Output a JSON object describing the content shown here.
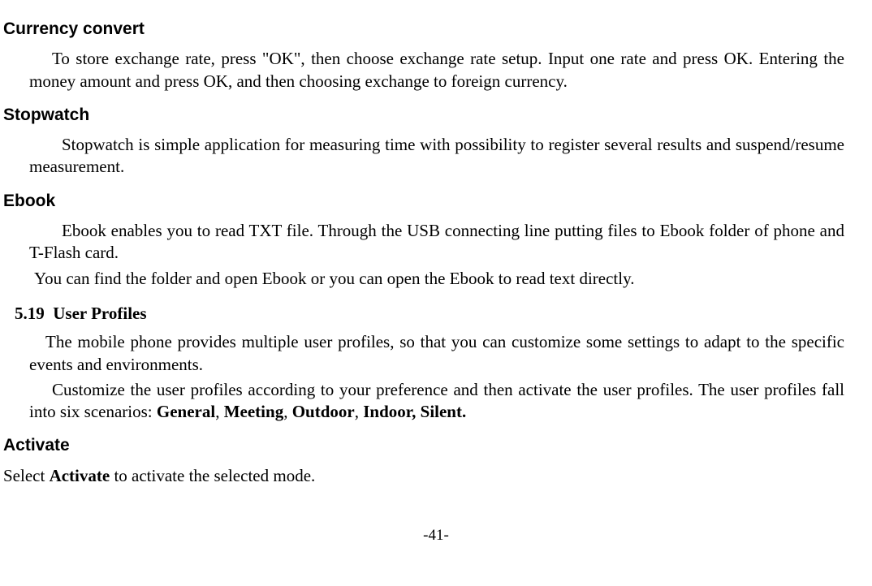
{
  "currency": {
    "heading": "Currency convert",
    "para": "To store exchange rate, press \"OK\", then choose exchange rate setup. Input one rate and press OK. Entering the money amount and press OK, and then choosing exchange to foreign currency."
  },
  "stopwatch": {
    "heading": "Stopwatch",
    "para": "Stopwatch is simple application for measuring time with possibility to register several results and suspend/resume measurement."
  },
  "ebook": {
    "heading": "Ebook",
    "para1": "Ebook enables you to read TXT file. Through the USB connecting line putting files to Ebook folder of phone and T-Flash card.",
    "para2": "You can find the folder and open Ebook or you can open the Ebook to read text directly."
  },
  "userprofiles": {
    "number": "5.19",
    "title": "User Profiles",
    "para1": "The mobile phone provides multiple user profiles, so that you can customize some settings to adapt to the specific events and environments.",
    "para2_pre": "Customize the user profiles according to your preference and then activate the user profiles. The user profiles fall into six scenarios: ",
    "s1": "General",
    "c1": ", ",
    "s2": "Meeting",
    "c2": ", ",
    "s3": "Outdoor",
    "c3": ", ",
    "s4": "Indoor, Silent."
  },
  "activate": {
    "heading": "Activate",
    "pre": "Select ",
    "bold": "Activate",
    "post": " to activate the selected mode."
  },
  "page_number": "-41-"
}
